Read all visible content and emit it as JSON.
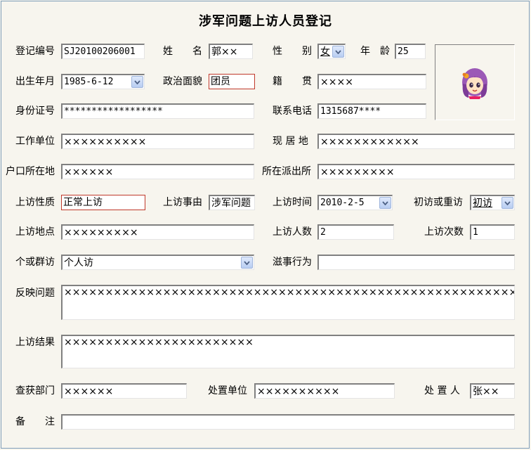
{
  "title": "涉军问题上访人员登记",
  "labels": {
    "reg_no": "登记编号",
    "name": "姓　　名",
    "gender": "性　　别",
    "age": "年　龄",
    "birth": "出生年月",
    "political": "政治面貌",
    "native": "籍　　贯",
    "id_no": "身份证号",
    "phone": "联系电话",
    "work_unit": "工作单位",
    "residence": "现 居 地",
    "hukou": "户口所在地",
    "police_station": "所在派出所",
    "petition_nature": "上访性质",
    "petition_reason": "上访事由",
    "petition_time": "上访时间",
    "first_or_repeat": "初访或重访",
    "petition_place": "上访地点",
    "petition_people": "上访人数",
    "petition_count": "上访次数",
    "individual_group": "个或群访",
    "trouble": "滋事行为",
    "issue": "反映问题",
    "result": "上访结果",
    "seize_dept": "查获部门",
    "handle_unit": "处置单位",
    "handler": "处 置 人",
    "remark": "备　　注"
  },
  "values": {
    "reg_no": "SJ20100206001",
    "name": "郭××",
    "gender": "女",
    "age": "25",
    "birth": "1985-6-12",
    "political": "团员",
    "native": "××××",
    "id_no": "******************",
    "phone": "1315687****",
    "work_unit": "××××××××××",
    "residence": "××××××××××××",
    "hukou": "××××××",
    "police_station": "×××××××××",
    "petition_nature": "正常上访",
    "petition_reason": "涉军问题",
    "petition_time": "2010-2-5",
    "first_or_repeat": "初访",
    "petition_place": "×××××××××",
    "petition_people": "2",
    "petition_count": "1",
    "individual_group": "个人访",
    "trouble": "",
    "issue": "×××××××××××××××××××××××××××××××××××××××××××××××××××××××××",
    "result": "×××××××××××××××××××××××",
    "seize_dept": "××××××",
    "handle_unit": "××××××××××",
    "handler": "张××",
    "remark": ""
  },
  "icons": {
    "dropdown": "chevron-down-icon",
    "photo": "avatar-girl-icon"
  },
  "colors": {
    "accent_border": "#c0392b",
    "dropdown_arrow": "#4d6185"
  }
}
